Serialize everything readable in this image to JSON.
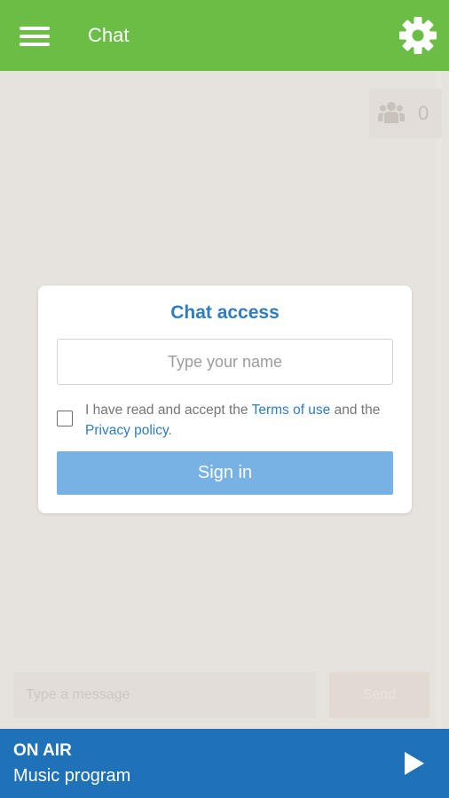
{
  "header": {
    "title": "Chat",
    "menu_icon": "hamburger-menu-icon",
    "settings_icon": "gear-icon",
    "color": "#6cbd45"
  },
  "users": {
    "icon": "users-group-icon",
    "count": "0"
  },
  "chat_access": {
    "title": "Chat access",
    "name_placeholder": "Type your name",
    "terms_prefix": "I have read and accept the ",
    "terms_link": "Terms of use",
    "terms_middle": " and the ",
    "privacy_link": "Privacy policy",
    "terms_suffix": ".",
    "accepted": false,
    "signin_label": "Sign in",
    "link_color": "#2f7cc1",
    "button_color": "#78b1e4"
  },
  "composer": {
    "message_placeholder": "Type a message",
    "send_label": "Send"
  },
  "player": {
    "status": "ON AIR",
    "program": "Music program",
    "play_icon": "play-icon",
    "color": "#1f72b8"
  }
}
